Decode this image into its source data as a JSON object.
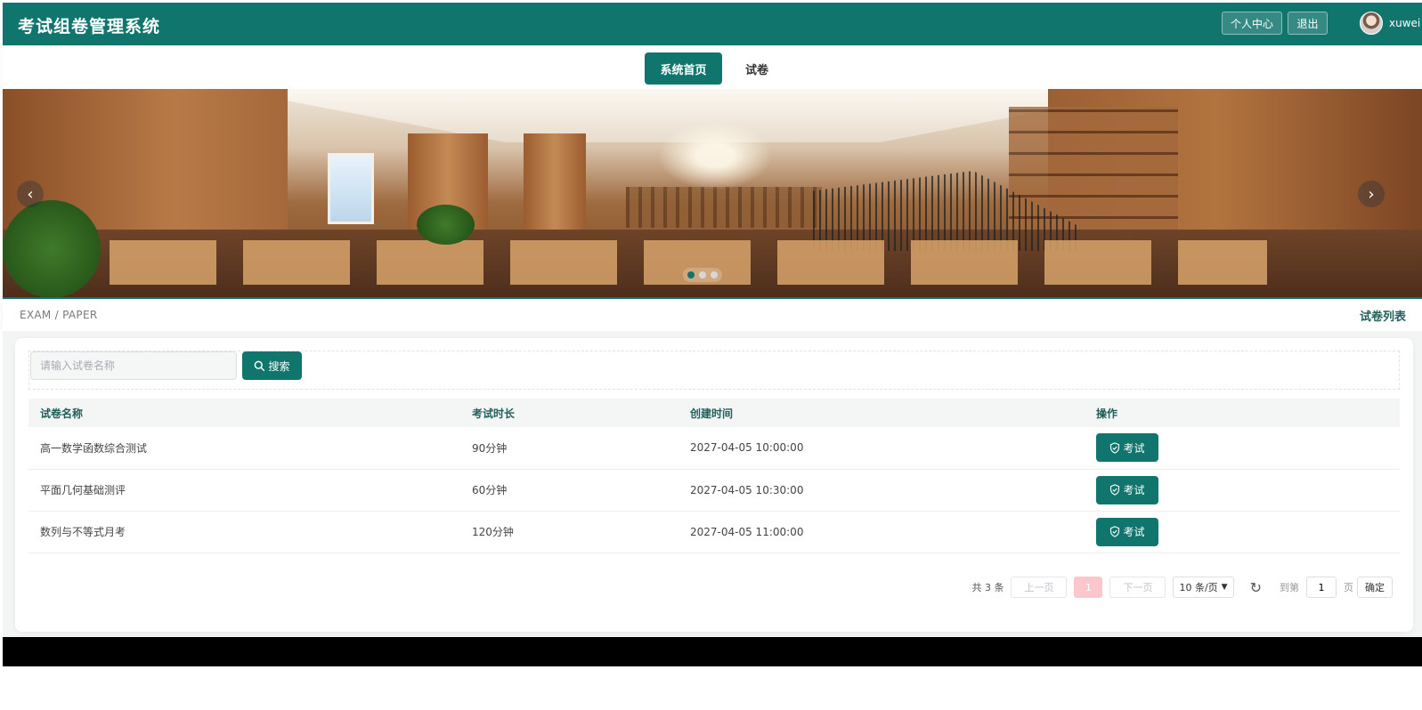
{
  "header": {
    "title": "考试组卷管理系统",
    "personal_center": "个人中心",
    "logout": "退出",
    "username": "xuwei"
  },
  "nav": {
    "home": "系统首页",
    "papers": "试卷"
  },
  "carousel": {
    "prev_icon": "chevron-left-icon",
    "next_icon": "chevron-right-icon",
    "slide_count": 3,
    "active_slide": 1
  },
  "breadcrumb": {
    "path": "EXAM / PAPER",
    "title": "试卷列表"
  },
  "search": {
    "placeholder": "请输入试卷名称",
    "button_label": "搜索"
  },
  "table": {
    "headers": [
      "试卷名称",
      "考试时长",
      "创建时间",
      "操作"
    ],
    "action_label": "考试",
    "rows": [
      {
        "name": "高一数学函数综合测试",
        "duration": "90分钟",
        "created": "2027-04-05 10:00:00"
      },
      {
        "name": "平面几何基础测评",
        "duration": "60分钟",
        "created": "2027-04-05 10:30:00"
      },
      {
        "name": "数列与不等式月考",
        "duration": "120分钟",
        "created": "2027-04-05 11:00:00"
      }
    ]
  },
  "pagination": {
    "total": "共 3 条",
    "prev": "上一页",
    "current": "1",
    "next": "下一页",
    "page_size": "10 条/页",
    "goto_prefix": "到第",
    "goto_value": "1",
    "goto_suffix": "页",
    "confirm": "确定"
  },
  "colors": {
    "primary": "#0f756d",
    "active_page": "#fbc6cc"
  }
}
